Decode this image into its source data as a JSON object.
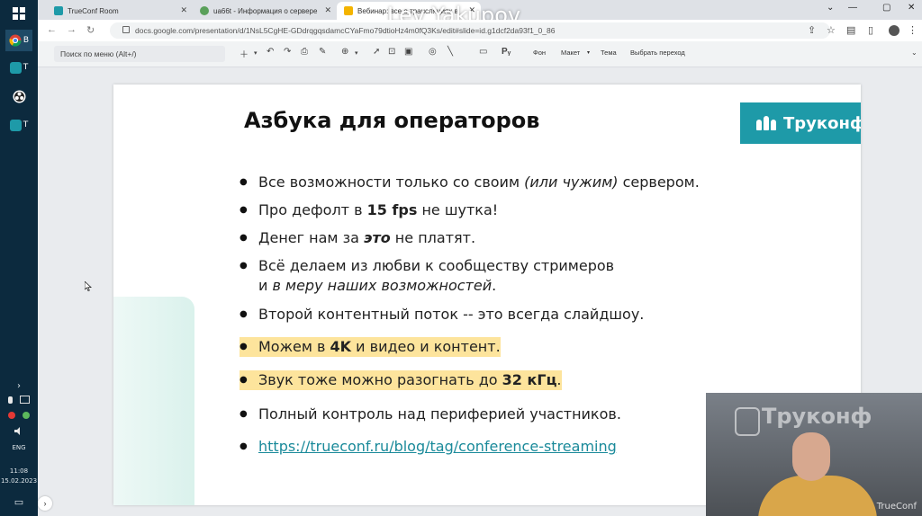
{
  "watermark": "Lev Yakupov",
  "taskbar": {
    "items": [
      {
        "label": "B",
        "icon": "chrome-icon"
      },
      {
        "label": "T",
        "icon": "trueconf-icon"
      },
      {
        "label": "",
        "icon": "obs-icon"
      },
      {
        "label": "T",
        "icon": "trueconf-icon"
      }
    ],
    "lang": "ENG",
    "time": "11:08",
    "date": "15.02.2023"
  },
  "browser": {
    "tabs": [
      {
        "title": "TrueConf Room",
        "active": false
      },
      {
        "title": "ua66t - Информация о сервере",
        "active": false
      },
      {
        "title": "Вебинар: все о трансляциях в",
        "active": true
      }
    ],
    "url": "docs.google.com/presentation/d/1NsL5CgHE-GDdrqgqsdamcCYaFmo79dtioHz4m0fQ3Ks/edit#slide=id.g1dcf2da93f1_0_86"
  },
  "toolbar": {
    "search_placeholder": "Поиск по меню (Alt+/)",
    "bg_label": "Фон",
    "layout_label": "Макет",
    "theme_label": "Тема",
    "transition_label": "Выбрать переход"
  },
  "slide": {
    "title": "Азбука для операторов",
    "logo_text": "Труконф",
    "bullets": [
      {
        "pre": "Все возможности только со своим ",
        "em": "(или чужим)",
        "post": " сервером."
      },
      {
        "pre": "Про дефолт в ",
        "strong": "15 fps",
        "post": " не шутка!"
      },
      {
        "pre": "Денег нам за ",
        "strongem": "это",
        "post": " не платят."
      },
      {
        "line1": "Всё делаем из любви к сообществу стримеров",
        "line2_pre": "и ",
        "line2_em": "в меру наших возможностей",
        "line2_post": "."
      },
      {
        "text": "Второй контентный поток -- это всегда слайдшоу."
      },
      {
        "pre": "Можем в ",
        "strong": "4K",
        "post": " и видео и контент.",
        "highlight": true
      },
      {
        "pre": "Звук тоже можно разогнать до ",
        "strong": "32 кГц",
        "post": ".",
        "highlight": true
      },
      {
        "text": "Полный контроль над периферией участников."
      },
      {
        "link": "https://trueconf.ru/blog/tag/conference-streaming"
      }
    ]
  },
  "webcam": {
    "brand": "Труконф",
    "corner": "TrueConf"
  }
}
